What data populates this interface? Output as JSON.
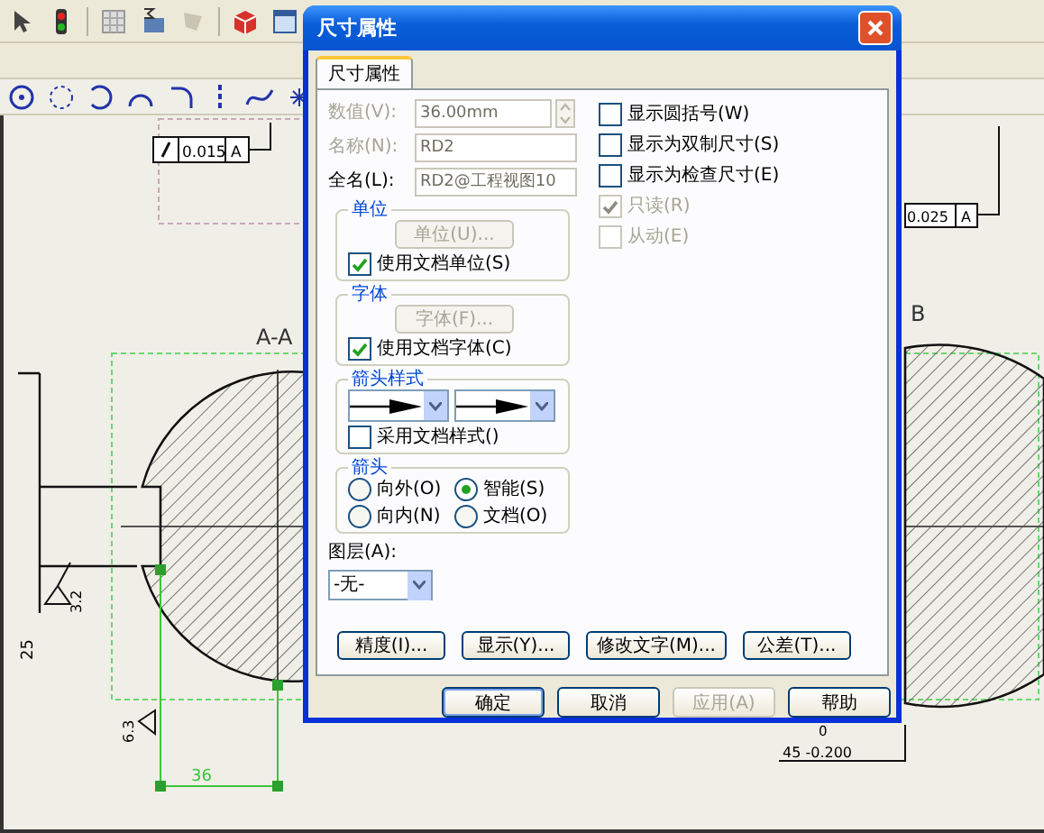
{
  "dialog": {
    "title": "尺寸属性",
    "tabs": [
      {
        "label": "尺寸属性",
        "selected": true
      }
    ],
    "fields": [
      {
        "kind": "spin",
        "label": "数值(V):",
        "value": "36.00mm",
        "disabled": true
      },
      {
        "kind": "text",
        "label": "名称(N):",
        "value": "RD2",
        "disabled": true
      },
      {
        "kind": "text",
        "label": "全名(L):",
        "value": "RD2@工程视图10",
        "disabled": false
      }
    ],
    "groups": [
      {
        "kind": "button",
        "title": "单位",
        "button": {
          "label": "单位(U)...",
          "disabled": true
        },
        "checkbox": {
          "label": "使用文档单位(S)",
          "checked": true
        }
      },
      {
        "kind": "button",
        "title": "字体",
        "button": {
          "label": "字体(F)...",
          "disabled": true
        },
        "checkbox": {
          "label": "使用文档字体(C)",
          "checked": true
        }
      },
      {
        "kind": "arrows",
        "title": "箭头样式",
        "checkbox": {
          "label": "采用文档样式()",
          "checked": false
        }
      },
      {
        "kind": "radios",
        "title": "箭头",
        "radios": [
          {
            "label": "向外(O)",
            "selected": false
          },
          {
            "label": "智能(S)",
            "selected": true
          },
          {
            "label": "向内(N)",
            "selected": false
          },
          {
            "label": "文档(O)",
            "selected": false
          }
        ]
      }
    ],
    "options": [
      {
        "label": "显示圆括号(W)",
        "checked": false,
        "disabled": false
      },
      {
        "label": "显示为双制尺寸(S)",
        "checked": false,
        "disabled": false
      },
      {
        "label": "显示为检查尺寸(E)",
        "checked": false,
        "disabled": false
      },
      {
        "label": "只读(R)",
        "checked": true,
        "disabled": true
      },
      {
        "label": "从动(E)",
        "checked": false,
        "disabled": true
      }
    ],
    "layer": {
      "label": "图层(A):",
      "value": "-无-"
    },
    "actions": [
      {
        "label": "精度(I)..."
      },
      {
        "label": "显示(Y)..."
      },
      {
        "label": "修改文字(M)..."
      },
      {
        "label": "公差(T)..."
      }
    ],
    "footer": [
      {
        "label": "确定",
        "disabled": false,
        "default": true
      },
      {
        "label": "取消",
        "disabled": false,
        "default": false
      },
      {
        "label": "应用(A)",
        "disabled": true,
        "default": false
      },
      {
        "label": "帮助",
        "disabled": false,
        "default": false
      }
    ]
  },
  "drawing": {
    "view_title": "A-A",
    "view_title_2": "B",
    "tolerance": "0.015",
    "datum": "A",
    "tolerance_2": "0.025",
    "datum_2": "A",
    "width_dimension": "36",
    "height_dimension": "25",
    "roughness": "3.2",
    "roughness_2": "6.3",
    "bottom_tolerance_upper": "0",
    "bottom_dimension": "45 -0.200"
  }
}
